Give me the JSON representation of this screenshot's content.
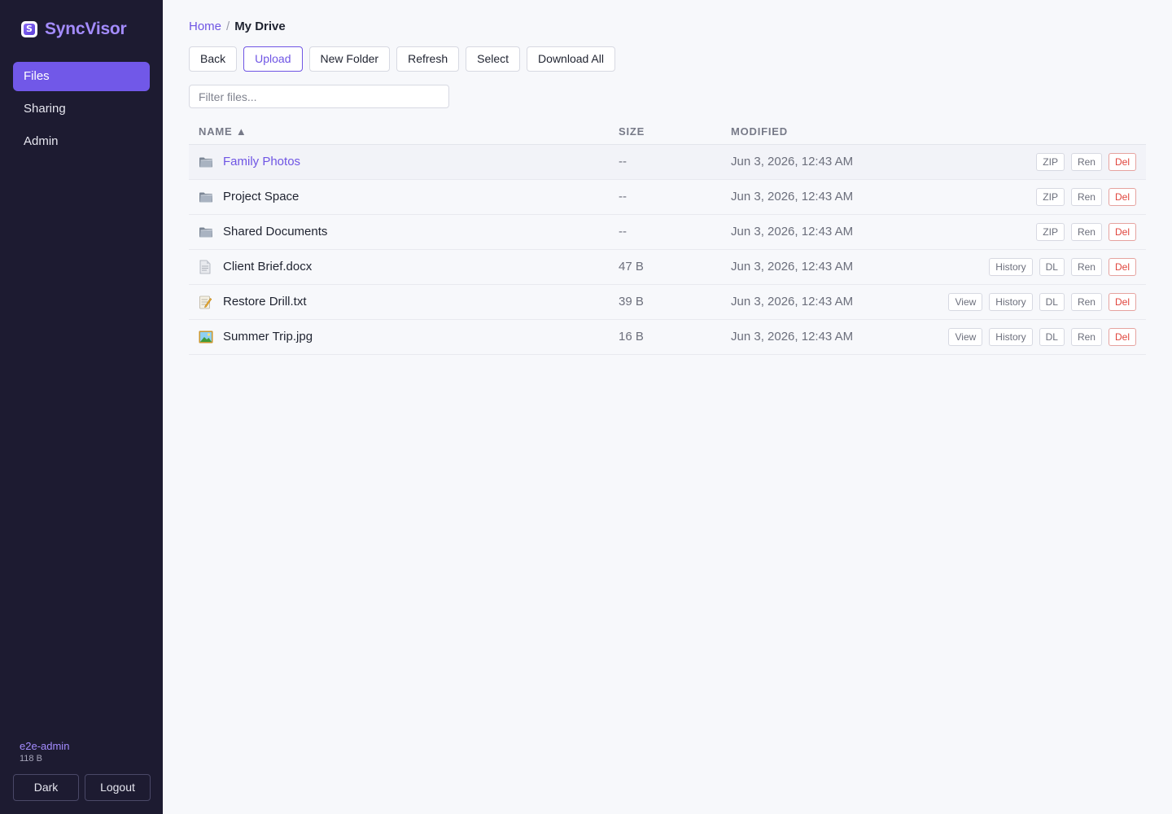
{
  "app": {
    "name": "SyncVisor",
    "logo_letter": "S",
    "brand_color": "#a48cff",
    "accent_color": "#7158e8"
  },
  "sidebar": {
    "items": [
      {
        "label": "Files",
        "active": true
      },
      {
        "label": "Sharing",
        "active": false
      },
      {
        "label": "Admin",
        "active": false
      }
    ],
    "user": {
      "name": "e2e-admin",
      "usage": "118 B"
    },
    "buttons": {
      "theme_label": "Dark",
      "logout_label": "Logout"
    }
  },
  "breadcrumb": {
    "home": "Home",
    "separator": "/",
    "current": "My Drive"
  },
  "toolbar": {
    "back_label": "Back",
    "upload_label": "Upload",
    "new_folder_label": "New Folder",
    "refresh_label": "Refresh",
    "select_label": "Select",
    "download_all_label": "Download All"
  },
  "filter": {
    "placeholder": "Filter files...",
    "value": ""
  },
  "table": {
    "headers": {
      "name": "NAME ▲",
      "size": "SIZE",
      "modified": "MODIFIED"
    },
    "rows": [
      {
        "icon": "folder-icon",
        "name": "Family Photos",
        "size": "--",
        "modified": "Jun 3, 2026, 12:43 AM",
        "actions": [
          "ZIP",
          "Ren",
          "Del"
        ]
      },
      {
        "icon": "folder-icon",
        "name": "Project Space",
        "size": "--",
        "modified": "Jun 3, 2026, 12:43 AM",
        "actions": [
          "ZIP",
          "Ren",
          "Del"
        ]
      },
      {
        "icon": "folder-icon",
        "name": "Shared Documents",
        "size": "--",
        "modified": "Jun 3, 2026, 12:43 AM",
        "actions": [
          "ZIP",
          "Ren",
          "Del"
        ]
      },
      {
        "icon": "document-icon",
        "name": "Client Brief.docx",
        "size": "47 B",
        "modified": "Jun 3, 2026, 12:43 AM",
        "actions": [
          "History",
          "DL",
          "Ren",
          "Del"
        ]
      },
      {
        "icon": "memo-icon",
        "name": "Restore Drill.txt",
        "size": "39 B",
        "modified": "Jun 3, 2026, 12:43 AM",
        "actions": [
          "View",
          "History",
          "DL",
          "Ren",
          "Del"
        ]
      },
      {
        "icon": "image-icon",
        "name": "Summer Trip.jpg",
        "size": "16 B",
        "modified": "Jun 3, 2026, 12:43 AM",
        "actions": [
          "View",
          "History",
          "DL",
          "Ren",
          "Del"
        ]
      }
    ]
  }
}
